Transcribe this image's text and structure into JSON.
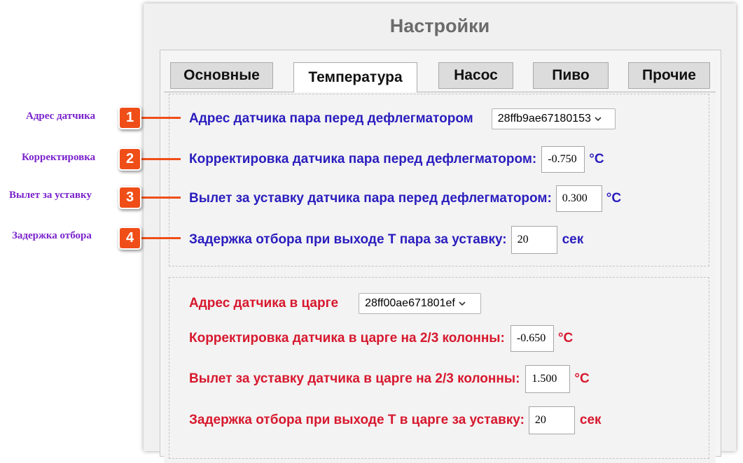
{
  "page_title": "Настройки",
  "tabs": [
    {
      "label": "Основные",
      "active": false
    },
    {
      "label": "Температура",
      "active": true
    },
    {
      "label": "Насос",
      "active": false
    },
    {
      "label": "Пиво",
      "active": false
    },
    {
      "label": "Прочие",
      "active": false
    }
  ],
  "steam_sensor": {
    "address_label": "Адрес датчика пара перед дефлегматором",
    "address_value": "28ffb9ae67180153",
    "correction_label": "Корректировка датчика пара перед дефлегматором:",
    "correction_value": "-0.750",
    "correction_unit": "°C",
    "overshoot_label": "Вылет за уставку датчика пара перед дефлегматором:",
    "overshoot_value": "0.300",
    "overshoot_unit": "°C",
    "delay_label": "Задержка отбора при выходе Т пара за уставку:",
    "delay_value": "20",
    "delay_unit": "сек"
  },
  "column_sensor": {
    "address_label": "Адрес датчика в царге",
    "address_value": "28ff00ae671801ef",
    "correction_label": "Корректировка датчика в царге на 2/3 колонны:",
    "correction_value": "-0.650",
    "correction_unit": "°C",
    "overshoot_label": "Вылет за уставку датчика в царге на 2/3 колонны:",
    "overshoot_value": "1.500",
    "overshoot_unit": "°C",
    "delay_label": "Задержка отбора при выходе Т в царге за уставку:",
    "delay_value": "20",
    "delay_unit": "сек"
  },
  "annotations": [
    {
      "number": "1",
      "label": "Адрес датчика"
    },
    {
      "number": "2",
      "label": "Корректировка"
    },
    {
      "number": "3",
      "label": "Вылет за уставку"
    },
    {
      "number": "4",
      "label": "Задержка отбора"
    }
  ],
  "colors": {
    "blue_text": "#2a1dbe",
    "red_text": "#d7182e",
    "annotation_label": "#7a22cc",
    "badge": "#f04e18"
  }
}
